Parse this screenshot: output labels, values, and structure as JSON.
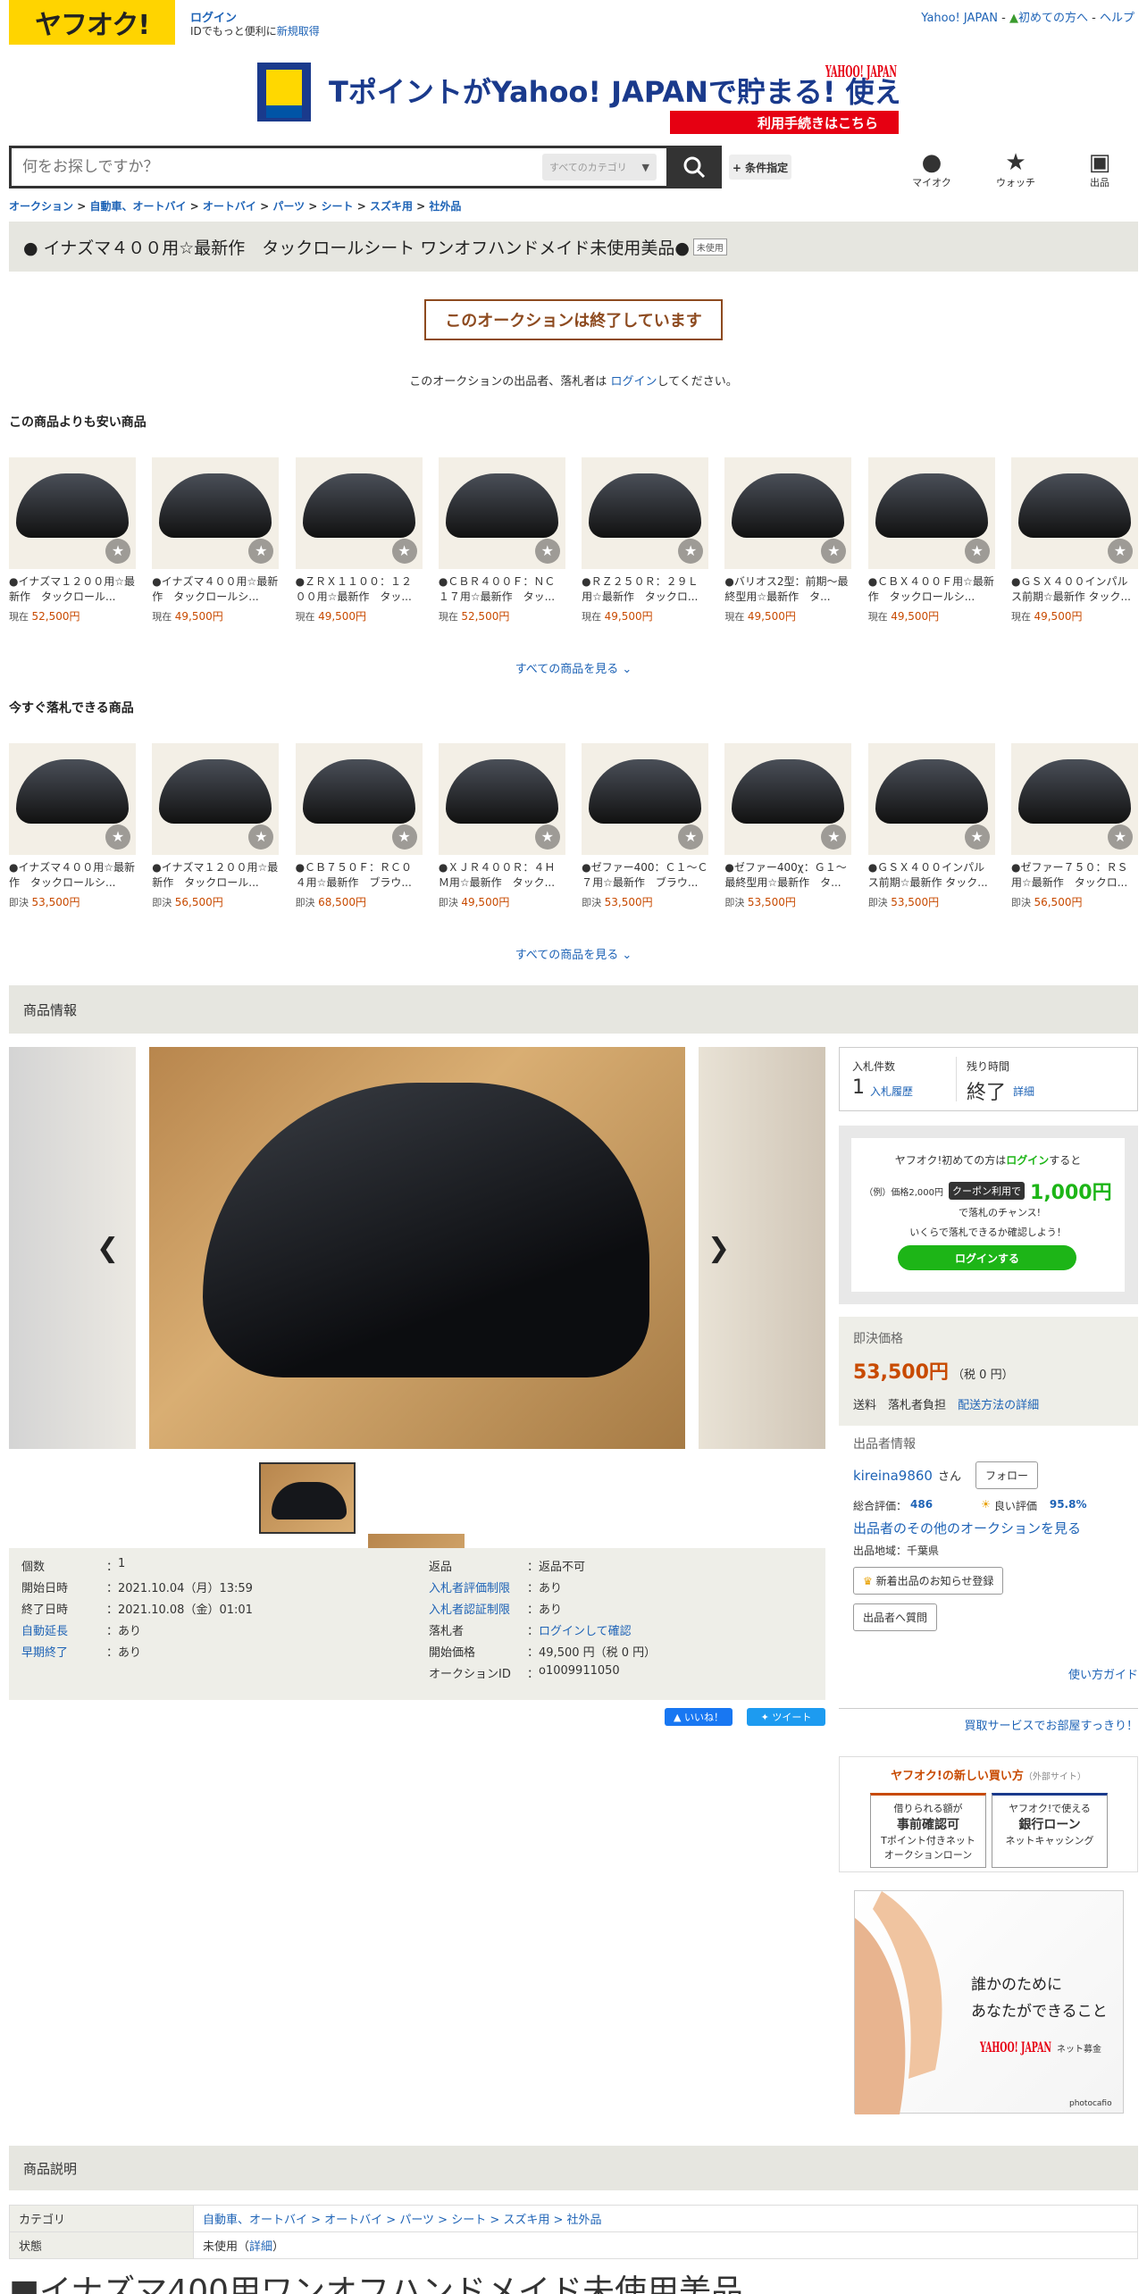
{
  "header": {
    "logo": "ヤフオク!",
    "login": "ログイン",
    "login_sub_prefix": "IDでもっと便利に",
    "register": "新規取得",
    "yahoo_japan": "Yahoo! JAPAN",
    "beginners": "初めての方へ",
    "help": "ヘルプ"
  },
  "banner": {
    "main": "TポイントがYahoo! JAPANで貯まる! 使える!",
    "brand": "YAHOO! JAPAN",
    "sub": "利用手続きはこちら"
  },
  "search": {
    "placeholder": "何をお探しですか？",
    "category": "すべてのカテゴリ",
    "conditions": "+ 条件指定"
  },
  "nav_icons": {
    "mypage": "マイオク",
    "watch": "ウォッチ",
    "sell": "出品"
  },
  "breadcrumb": [
    "オークション",
    "自動車、オートバイ",
    "オートバイ",
    "パーツ",
    "シート",
    "スズキ用",
    "社外品"
  ],
  "title": "● イナズマ４００用☆最新作　タックロールシート ワンオフハンドメイド未使用美品●",
  "condition_tag": "未使用",
  "ended": "このオークションは終了しています",
  "ended_msg_prefix": "このオークションの出品者、落札者は",
  "ended_msg_link": "ログイン",
  "ended_msg_suffix": "してください。",
  "cheaper": {
    "heading": "この商品よりも安い商品",
    "items": [
      {
        "title": "●イナズマ１２００用☆最新作　タックロール...",
        "price_label": "現在",
        "price": "52,500円"
      },
      {
        "title": "●イナズマ４００用☆最新作　タックロールシ...",
        "price_label": "現在",
        "price": "49,500円"
      },
      {
        "title": "●ＺＲＸ１１００：１２００用☆最新作　タッ...",
        "price_label": "現在",
        "price": "49,500円"
      },
      {
        "title": "●ＣＢＲ４００Ｆ：ＮＣ１７用☆最新作　タッ...",
        "price_label": "現在",
        "price": "52,500円"
      },
      {
        "title": "●ＲＺ２５０Ｒ：２９Ｌ用☆最新作　タックロ...",
        "price_label": "現在",
        "price": "49,500円"
      },
      {
        "title": "●バリオス2型：前期～最終型用☆最新作　タ...",
        "price_label": "現在",
        "price": "49,500円"
      },
      {
        "title": "●ＣＢＸ４００Ｆ用☆最新作　タックロールシ...",
        "price_label": "現在",
        "price": "49,500円"
      },
      {
        "title": "●ＧＳＸ４００インパルス前期☆最新作 タック...",
        "price_label": "現在",
        "price": "49,500円"
      }
    ],
    "more": "すべての商品を見る"
  },
  "buynow": {
    "heading": "今すぐ落札できる商品",
    "items": [
      {
        "title": "●イナズマ４００用☆最新作　タックロールシ...",
        "price_label": "即決",
        "price": "53,500円"
      },
      {
        "title": "●イナズマ１２００用☆最新作　タックロール...",
        "price_label": "即決",
        "price": "56,500円"
      },
      {
        "title": "●ＣＢ７５０Ｆ：ＲＣ０４用☆最新作　ブラウ...",
        "price_label": "即決",
        "price": "68,500円"
      },
      {
        "title": "●ＸＪＲ４００Ｒ：４ＨＭ用☆最新作　タック...",
        "price_label": "即決",
        "price": "49,500円"
      },
      {
        "title": "●ゼファー400：Ｃ１～Ｃ７用☆最新作　ブラウ...",
        "price_label": "即決",
        "price": "53,500円"
      },
      {
        "title": "●ゼファー400χ：Ｇ１～最終型用☆最新作　タ...",
        "price_label": "即決",
        "price": "53,500円"
      },
      {
        "title": "●ＧＳＸ４００インパルス前期☆最新作 タック...",
        "price_label": "即決",
        "price": "53,500円"
      },
      {
        "title": "●ゼファー７５０：ＲＳ用☆最新作　タックロ...",
        "price_label": "即決",
        "price": "56,500円"
      }
    ],
    "more": "すべての商品を見る"
  },
  "info_heading": "商品情報",
  "details": {
    "left": [
      {
        "k": "個数",
        "v": "1"
      },
      {
        "k": "開始日時",
        "v": "2021.10.04（月）13:59"
      },
      {
        "k": "終了日時",
        "v": "2021.10.08（金）01:01"
      },
      {
        "k": "自動延長",
        "v": "あり"
      },
      {
        "k": "早期終了",
        "v": "あり"
      }
    ],
    "right": [
      {
        "k": "返品",
        "v": "返品不可"
      },
      {
        "k": "入札者評価制限",
        "v": "あり"
      },
      {
        "k": "入札者認証制限",
        "v": "あり"
      },
      {
        "k": "落札者",
        "v": "ログインして確認"
      },
      {
        "k": "開始価格",
        "v": "49,500 円（税 0 円）"
      },
      {
        "k": "オークションID",
        "v": "o1009911050"
      }
    ]
  },
  "social": {
    "like": "いいね！",
    "tweet": "ツイート"
  },
  "bid": {
    "count_label": "入札件数",
    "count": "1",
    "history": "入札履歴",
    "time_label": "残り時間",
    "time": "終了",
    "detail": "詳細"
  },
  "promo": {
    "line1_prefix": "ヤフオク!初めての方は",
    "line1_link": "ログイン",
    "line1_suffix": "すると",
    "example": "（例）価格2,000円",
    "coupon": "クーポン利用で",
    "amount": "1,000円",
    "amount_suffix": "で落札のチャンス!",
    "check": "いくらで落札できるか確認しよう！",
    "button": "ログインする"
  },
  "price": {
    "label": "即決価格",
    "value": "53,500円",
    "tax": "（税 0 円）",
    "shipping_label": "送料",
    "shipping": "落札者負担",
    "shipping_link": "配送方法の詳細"
  },
  "seller": {
    "heading": "出品者情報",
    "name": "kireina9860",
    "san": "さん",
    "follow": "フォロー",
    "rating_label": "総合評価：",
    "rating": "486",
    "good_label": "良い評価",
    "good": "95.8%",
    "other": "出品者のその他のオークションを見る",
    "region": "出品地域：千葉県",
    "notify": "新着出品のお知らせ登録",
    "question": "出品者へ質問"
  },
  "guide": "使い方ガイド",
  "buy_service": "買取サービスでお部屋すっきり！",
  "new_way": {
    "title": "ヤフオク!の新しい買い方",
    "title_suffix": "（外部サイト）",
    "left": {
      "line1": "借りられる額が",
      "line2": "事前確認可",
      "line3": "Tポイント付きネット",
      "line4": "オークションローン"
    },
    "right": {
      "line1": "ヤフオク!で使える",
      "line2": "銀行ローン",
      "line3": "ネットキャッシング"
    }
  },
  "charity": {
    "line1": "誰かのために",
    "line2": "あなたができること",
    "brand": "YAHOO! JAPAN",
    "label": "ネット募金",
    "credit": "photocafio"
  },
  "description": {
    "heading": "商品説明",
    "rows": [
      {
        "k": "カテゴリ",
        "v": "自動車、オートバイ > オートバイ > パーツ > シート > スズキ用 > 社外品"
      },
      {
        "k": "状態",
        "v": "未使用",
        "link": "詳細"
      }
    ],
    "bottom_text": "■イナズマ400用ワンオフハンドメイド未使用美品"
  }
}
